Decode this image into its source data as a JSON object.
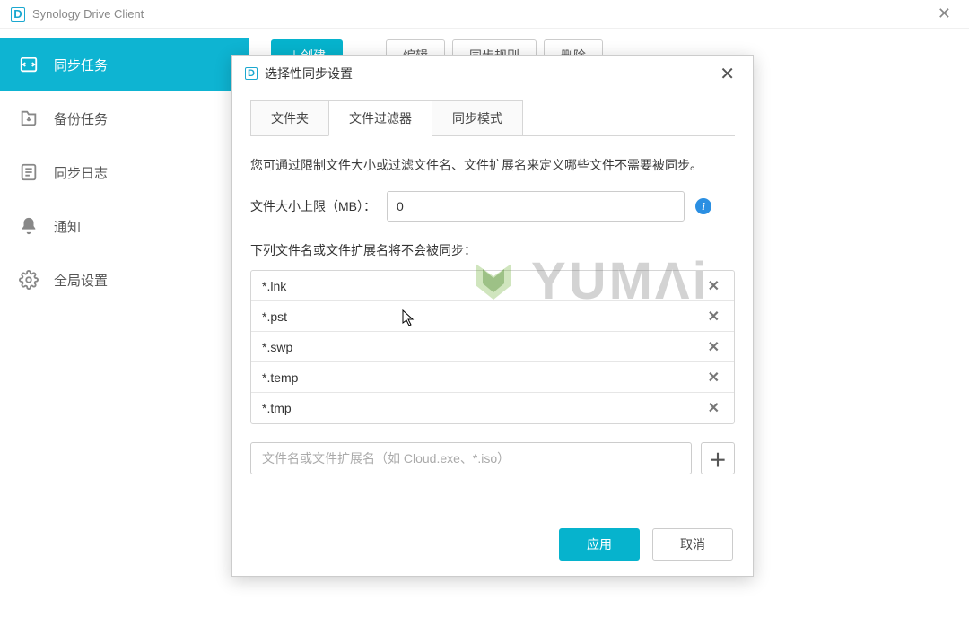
{
  "window": {
    "title": "Synology Drive Client",
    "brand_icon_label": "D"
  },
  "sidebar": {
    "items": [
      {
        "label": "同步任务"
      },
      {
        "label": "备份任务"
      },
      {
        "label": "同步日志"
      },
      {
        "label": "通知"
      },
      {
        "label": "全局设置"
      }
    ]
  },
  "toolbar": {
    "create": "创建",
    "edit": "编辑",
    "sync_rules": "同步规则",
    "delete": "删除"
  },
  "dialog": {
    "title": "选择性同步设置",
    "tabs": {
      "folder": "文件夹",
      "filter": "文件过滤器",
      "mode": "同步模式"
    },
    "filter": {
      "desc": "您可通过限制文件大小或过滤文件名、文件扩展名来定义哪些文件不需要被同步。",
      "size_label": "文件大小上限（MB）：",
      "size_value": "0",
      "exclude_desc": "下列文件名或文件扩展名将不会被同步：",
      "items": [
        "*.lnk",
        "*.pst",
        "*.swp",
        "*.temp",
        "*.tmp"
      ],
      "add_placeholder": "文件名或文件扩展名（如 Cloud.exe、*.iso）"
    },
    "buttons": {
      "apply": "应用",
      "cancel": "取消"
    }
  },
  "watermark": "YUMΛi"
}
